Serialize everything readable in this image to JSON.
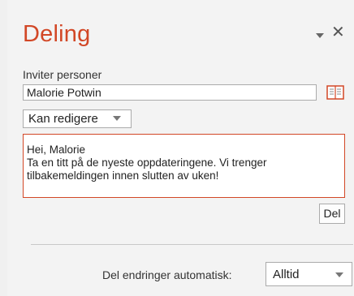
{
  "pane": {
    "title": "Deling",
    "close_symbol": "✕",
    "accent_color": "#d24726"
  },
  "invite": {
    "label": "Inviter personer",
    "name_value": "Malorie Potwin",
    "permission_selected": "Kan redigere"
  },
  "message": {
    "lines": [
      "Hei, Malorie",
      "Ta en titt på de nyeste oppdateringene. Vi trenger",
      "tilbakemeldingen innen slutten av uken!"
    ]
  },
  "share_button_label": "Del",
  "auto_share": {
    "label": "Del endringer automatisk:",
    "selected": "Alltid"
  },
  "icons": [
    "pin-icon",
    "close-icon",
    "address-book-icon",
    "chevron-down-icon"
  ]
}
